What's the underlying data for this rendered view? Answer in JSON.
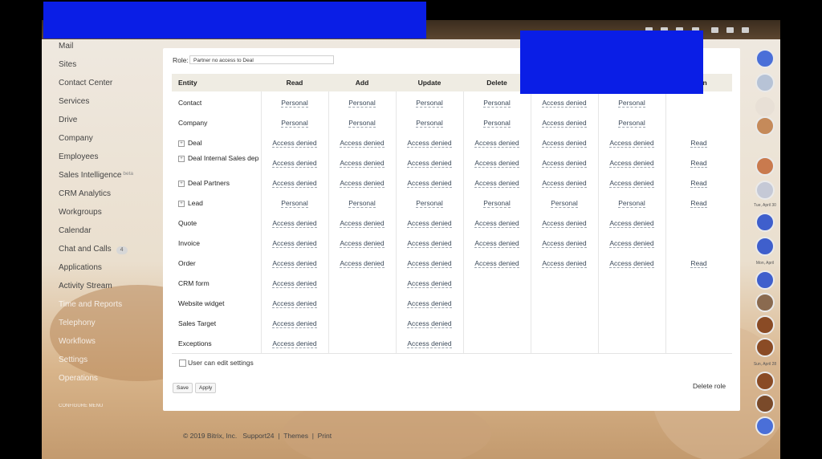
{
  "colors": {
    "redaction": "#0a1ee6",
    "panel_bg": "#ffffff",
    "header_bg": "#efece3",
    "link": "#3c4a5a"
  },
  "sidebar": {
    "items": [
      "Mail",
      "Sites",
      "Contact Center",
      "Services",
      "Drive",
      "Company",
      "Employees",
      "Sales Intelligence",
      "CRM Analytics",
      "Workgroups",
      "Calendar",
      "Chat and Calls",
      "Applications",
      "Activity Stream",
      "Time and Reports",
      "Telephony",
      "Workflows",
      "Settings",
      "Operations"
    ],
    "sales_intelligence_sup": "beta",
    "chat_badge": "4",
    "configure": "CONFIGURE MENU"
  },
  "role": {
    "label": "Role:",
    "value": "Partner no access to Deal"
  },
  "table": {
    "headers": [
      "Entity",
      "Read",
      "Add",
      "Update",
      "Delete",
      "",
      "",
      "ation"
    ],
    "rows": [
      {
        "entity": "Contact",
        "expand": false,
        "cells": [
          "Personal",
          "Personal",
          "Personal",
          "Personal",
          "Access denied",
          "Personal",
          ""
        ]
      },
      {
        "entity": "Company",
        "expand": false,
        "cells": [
          "Personal",
          "Personal",
          "Personal",
          "Personal",
          "Access denied",
          "Personal",
          ""
        ]
      },
      {
        "entity": "Deal",
        "expand": true,
        "cells": [
          "Access denied",
          "Access denied",
          "Access denied",
          "Access denied",
          "Access denied",
          "Access denied",
          "Read"
        ]
      },
      {
        "entity": "Deal Internal Sales dep",
        "expand": true,
        "cells": [
          "Access denied",
          "Access denied",
          "Access denied",
          "Access denied",
          "Access denied",
          "Access denied",
          "Read"
        ]
      },
      {
        "entity": "Deal Partners",
        "expand": true,
        "cells": [
          "Access denied",
          "Access denied",
          "Access denied",
          "Access denied",
          "Access denied",
          "Access denied",
          "Read"
        ]
      },
      {
        "entity": "Lead",
        "expand": true,
        "cells": [
          "Personal",
          "Personal",
          "Personal",
          "Personal",
          "Personal",
          "Personal",
          "Read"
        ]
      },
      {
        "entity": "Quote",
        "expand": false,
        "cells": [
          "Access denied",
          "Access denied",
          "Access denied",
          "Access denied",
          "Access denied",
          "Access denied",
          ""
        ]
      },
      {
        "entity": "Invoice",
        "expand": false,
        "cells": [
          "Access denied",
          "Access denied",
          "Access denied",
          "Access denied",
          "Access denied",
          "Access denied",
          ""
        ]
      },
      {
        "entity": "Order",
        "expand": false,
        "cells": [
          "Access denied",
          "Access denied",
          "Access denied",
          "Access denied",
          "Access denied",
          "Access denied",
          "Read"
        ]
      },
      {
        "entity": "CRM form",
        "expand": false,
        "cells": [
          "Access denied",
          "",
          "Access denied",
          "",
          "",
          "",
          ""
        ]
      },
      {
        "entity": "Website widget",
        "expand": false,
        "cells": [
          "Access denied",
          "",
          "Access denied",
          "",
          "",
          "",
          ""
        ]
      },
      {
        "entity": "Sales Target",
        "expand": false,
        "cells": [
          "Access denied",
          "",
          "Access denied",
          "",
          "",
          "",
          ""
        ]
      },
      {
        "entity": "Exceptions",
        "expand": false,
        "cells": [
          "Access denied",
          "",
          "Access denied",
          "",
          "",
          "",
          ""
        ]
      }
    ]
  },
  "user_can_edit": "User can edit settings",
  "buttons": {
    "save": "Save",
    "apply": "Apply",
    "delete_role": "Delete role"
  },
  "footer": {
    "copyright": "© 2019 Bitrix, Inc.",
    "support": "Support24",
    "themes": "Themes",
    "print": "Print",
    "sep": "|"
  },
  "right_bar": {
    "dates": [
      "Tue, April 30",
      "Mon, April",
      "Sun, April 28"
    ]
  }
}
